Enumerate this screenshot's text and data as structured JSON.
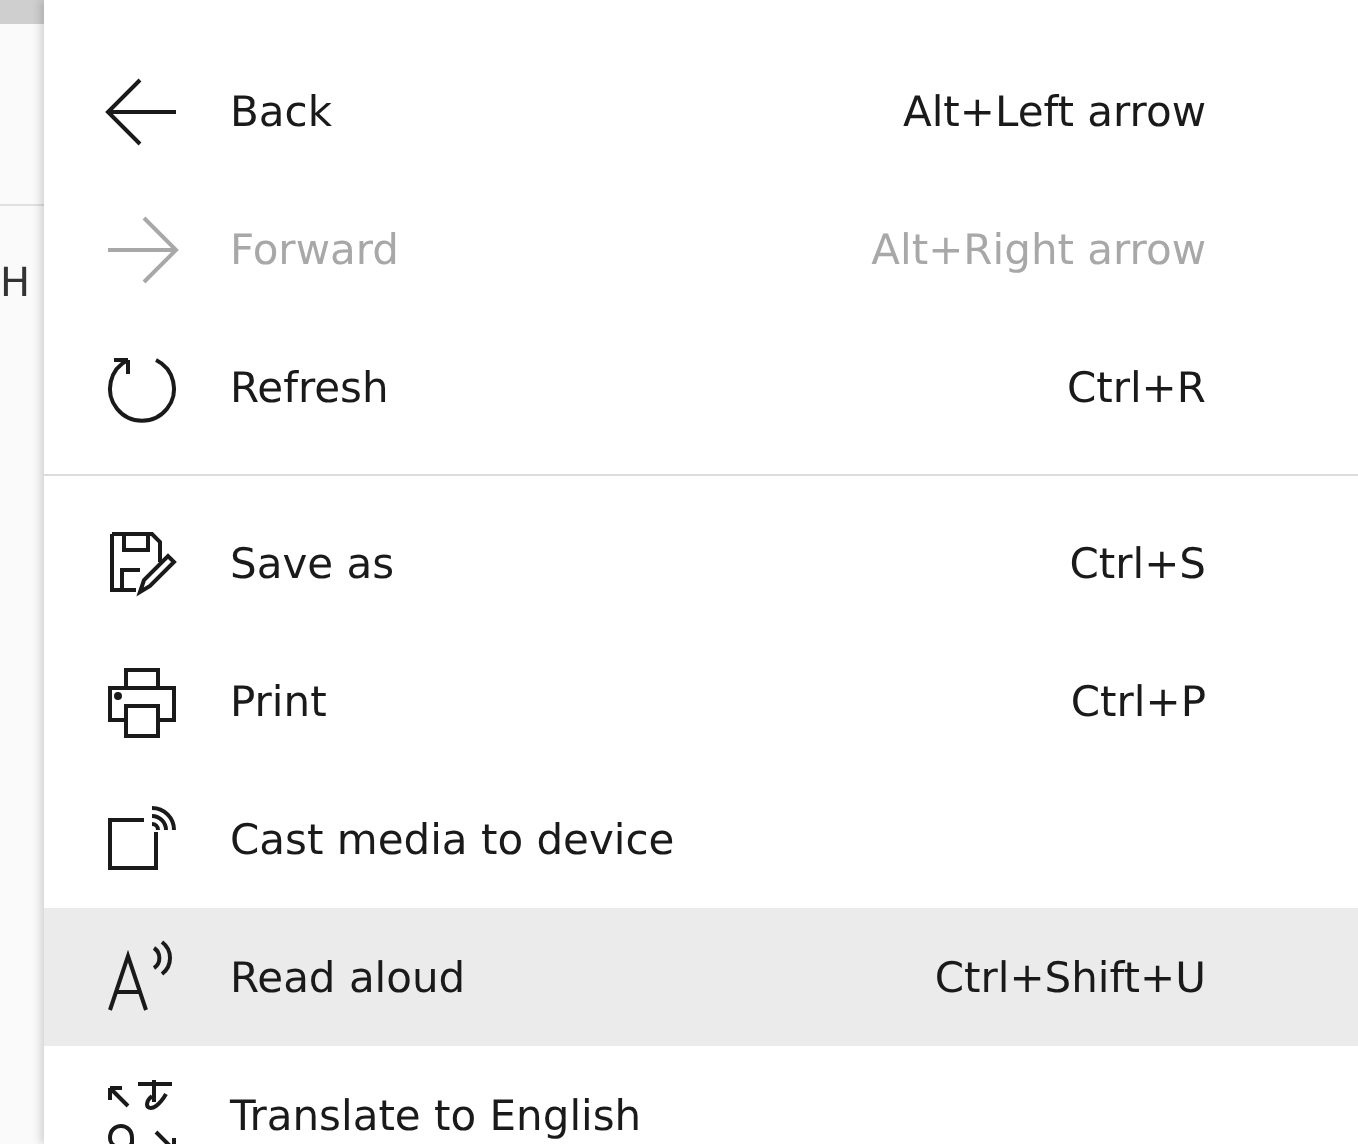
{
  "background": {
    "fragment": "H"
  },
  "menu": {
    "sections": [
      {
        "items": [
          {
            "label": "Back",
            "shortcut": "Alt+Left arrow",
            "disabled": false,
            "highlighted": false
          },
          {
            "label": "Forward",
            "shortcut": "Alt+Right arrow",
            "disabled": true,
            "highlighted": false
          },
          {
            "label": "Refresh",
            "shortcut": "Ctrl+R",
            "disabled": false,
            "highlighted": false
          }
        ]
      },
      {
        "items": [
          {
            "label": "Save as",
            "shortcut": "Ctrl+S",
            "disabled": false,
            "highlighted": false
          },
          {
            "label": "Print",
            "shortcut": "Ctrl+P",
            "disabled": false,
            "highlighted": false
          },
          {
            "label": "Cast media to device",
            "disabled": false,
            "highlighted": false
          },
          {
            "label": "Read aloud",
            "shortcut": "Ctrl+Shift+U",
            "disabled": false,
            "highlighted": true
          },
          {
            "label": "Translate to English",
            "disabled": false,
            "highlighted": false
          }
        ]
      }
    ]
  }
}
